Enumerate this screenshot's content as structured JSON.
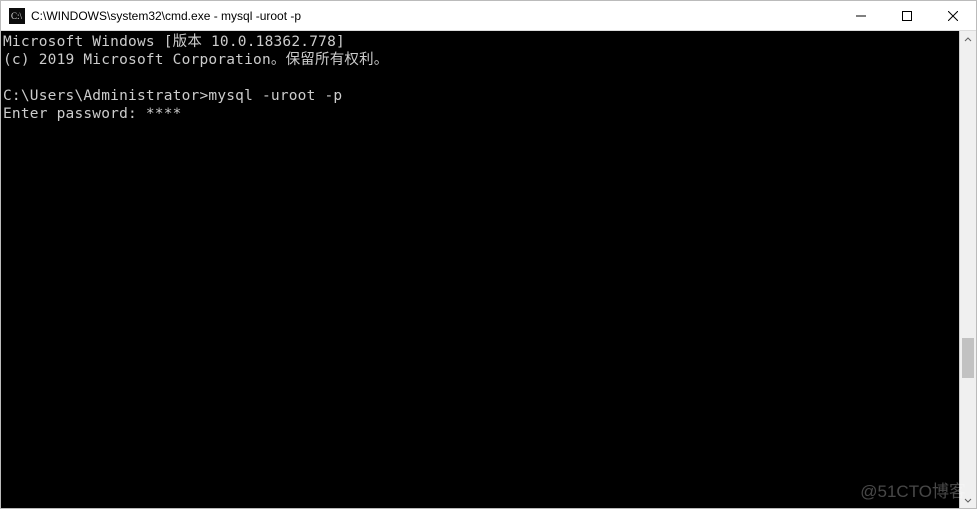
{
  "titlebar": {
    "title": "C:\\WINDOWS\\system32\\cmd.exe - mysql  -uroot -p"
  },
  "terminal": {
    "line1": "Microsoft Windows [版本 10.0.18362.778]",
    "line2": "(c) 2019 Microsoft Corporation。保留所有权利。",
    "blank1": "",
    "prompt_line": "C:\\Users\\Administrator>mysql -uroot -p",
    "password_line": "Enter password: ****"
  },
  "watermark": "@51CTO博客"
}
